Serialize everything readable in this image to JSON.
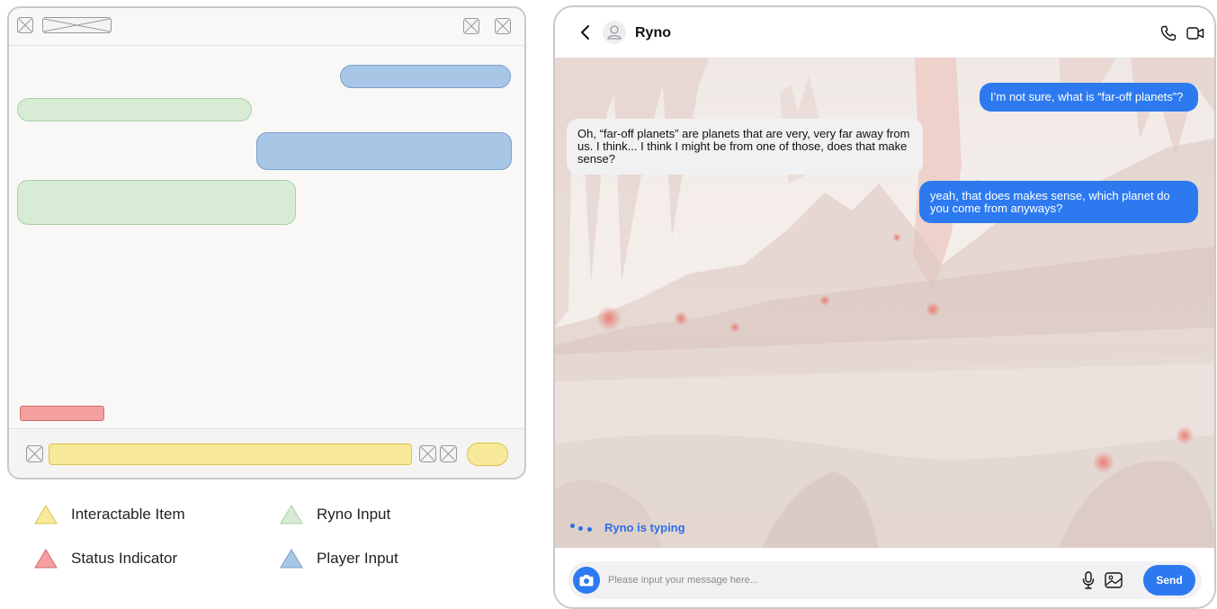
{
  "legend": {
    "items": [
      {
        "label": "Interactable Item",
        "color": "#f8e99a"
      },
      {
        "label": "Status Indicator",
        "color": "#f4a0a0"
      },
      {
        "label": "Ryno Input",
        "color": "#d7ebd5"
      },
      {
        "label": "Player Input",
        "color": "#a8c6e6"
      }
    ]
  },
  "chat": {
    "contact_name": "Ryno",
    "messages": [
      {
        "sender": "player",
        "text": "I’m not sure, what is “far-off planets”?"
      },
      {
        "sender": "ryno",
        "text": "Oh, “far-off planets” are planets that are very, very far away from us. I think... I think I might be from one of those, does that make sense?"
      },
      {
        "sender": "player",
        "text": "yeah, that does makes sense, which planet do you come from anyways?"
      }
    ],
    "typing_status": "Ryno is typing",
    "input_placeholder": "Please input your message here...",
    "send_label": "Send"
  },
  "icons": {
    "back": "chevron-left-icon",
    "avatar": "user-icon",
    "call": "phone-icon",
    "video": "video-camera-icon",
    "camera": "camera-icon",
    "mic": "microphone-icon",
    "gallery": "image-icon"
  },
  "colors": {
    "accent": "#2d7af0",
    "player_bubble": "#2d7af0",
    "ryno_bubble": "#f1f1f3",
    "typing_text": "#2d6fe6"
  }
}
